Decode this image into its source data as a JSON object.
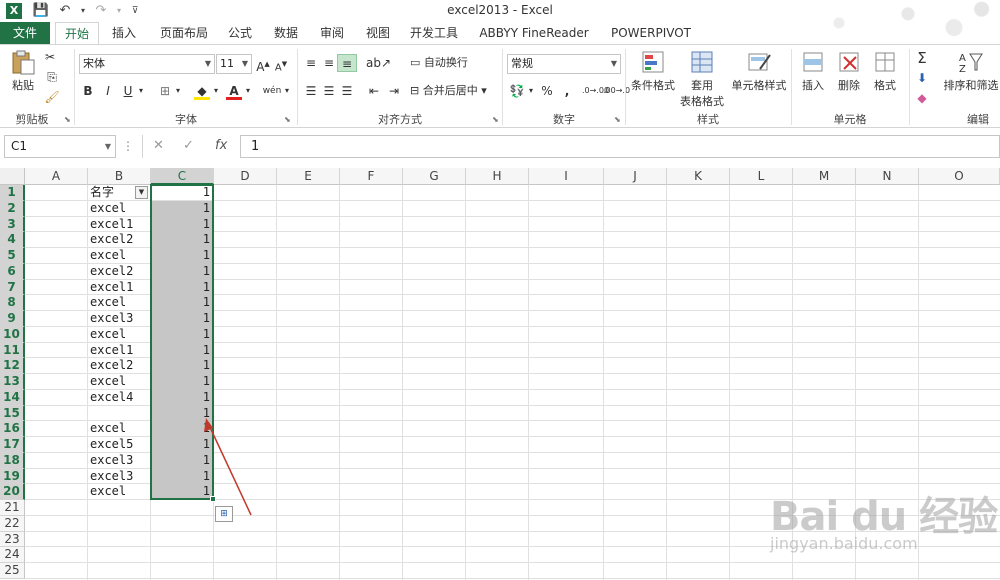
{
  "titlebar": {
    "title": "excel2013 - Excel",
    "app_icon": "X"
  },
  "tabs": [
    {
      "label": "文件"
    },
    {
      "label": "开始"
    },
    {
      "label": "插入"
    },
    {
      "label": "页面布局"
    },
    {
      "label": "公式"
    },
    {
      "label": "数据"
    },
    {
      "label": "审阅"
    },
    {
      "label": "视图"
    },
    {
      "label": "开发工具"
    },
    {
      "label": "ABBYY FineReader 12"
    },
    {
      "label": "POWERPIVOT"
    }
  ],
  "ribbon": {
    "clipboard": {
      "paste": "粘贴",
      "group": "剪贴板"
    },
    "font": {
      "name": "宋体",
      "size": "11",
      "group": "字体",
      "bold": "B",
      "italic": "I",
      "underline": "U",
      "phonetic": "wén"
    },
    "alignment": {
      "wrap": "自动换行",
      "merge": "合并后居中",
      "group": "对齐方式"
    },
    "number": {
      "format": "常规",
      "group": "数字",
      "percent": "%",
      "comma": ","
    },
    "styles": {
      "cond": "条件格式",
      "table1": "套用",
      "table2": "表格格式",
      "cell": "单元格样式",
      "group": "样式"
    },
    "cells": {
      "insert": "插入",
      "delete": "删除",
      "format": "格式",
      "group": "单元格"
    },
    "editing": {
      "sort": "排序和筛选",
      "group": "编辑"
    }
  },
  "formula_bar": {
    "name_box": "C1",
    "fx": "fx",
    "value": "1"
  },
  "columns": [
    "A",
    "B",
    "C",
    "D",
    "E",
    "F",
    "G",
    "H",
    "I",
    "J",
    "K",
    "L",
    "M",
    "N",
    "O"
  ],
  "rows": [
    "1",
    "2",
    "3",
    "4",
    "5",
    "6",
    "7",
    "8",
    "9",
    "10",
    "11",
    "12",
    "13",
    "14",
    "15",
    "16",
    "17",
    "18",
    "19",
    "20",
    "21",
    "22",
    "23",
    "24",
    "25"
  ],
  "col_b": [
    "名字",
    "excel",
    "excel1",
    "excel2",
    "excel",
    "excel2",
    "excel1",
    "excel",
    "excel3",
    "excel",
    "excel1",
    "excel2",
    "excel",
    "excel4",
    "",
    "excel",
    "excel5",
    "excel3",
    "excel3",
    "excel"
  ],
  "col_c": [
    "1",
    "1",
    "1",
    "1",
    "1",
    "1",
    "1",
    "1",
    "1",
    "1",
    "1",
    "1",
    "1",
    "1",
    "1",
    "1",
    "1",
    "1",
    "1",
    "1"
  ],
  "colors": {
    "accent": "#217346",
    "selection": "#c6c6c6",
    "arrow": "#c0392b"
  },
  "watermark": {
    "brand": "Bai du 经验",
    "url": "jingyan.baidu.com"
  }
}
